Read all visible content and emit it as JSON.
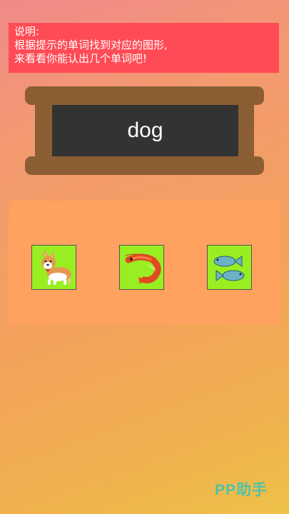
{
  "instructions": {
    "text": "说明:\n根据提示的单词找到对应的图形,\n来看看你能认出几个单词吧!"
  },
  "prompt_word": "dog",
  "choices": [
    {
      "icon": "corgi-dog-icon",
      "label": "dog"
    },
    {
      "icon": "shrimp-icon",
      "label": "shrimp"
    },
    {
      "icon": "two-fish-icon",
      "label": "fish"
    }
  ],
  "watermark": "PP助手",
  "colors": {
    "instruction_bg": "#ff4b55",
    "board_frame": "#8b5e34",
    "board": "#333333",
    "choice_panel": "#ffa15f",
    "choice_tile": "#99ee22",
    "watermark": "#4fc3a8"
  }
}
